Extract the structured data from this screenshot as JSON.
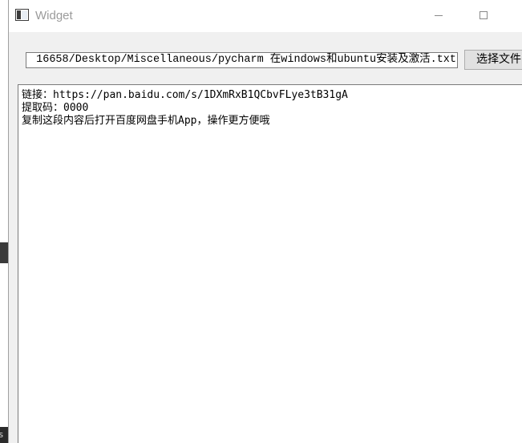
{
  "window": {
    "title": "Widget"
  },
  "toolbar": {
    "path_value": "16658/Desktop/Miscellaneous/pycharm  在windows和ubuntu安装及激活.txt",
    "choose_button_label": "选择文件"
  },
  "content": {
    "lines": [
      "链接：https://pan.baidu.com/s/1DXmRxB1QCbvFLye3tB31gA",
      "提取码：0000",
      "复制这段内容后打开百度网盘手机App，操作更方便哦"
    ]
  },
  "background": {
    "edge_text": "s"
  },
  "icons": {
    "app": "app-window-icon",
    "minimize": "minimize-icon",
    "maximize": "maximize-icon"
  }
}
